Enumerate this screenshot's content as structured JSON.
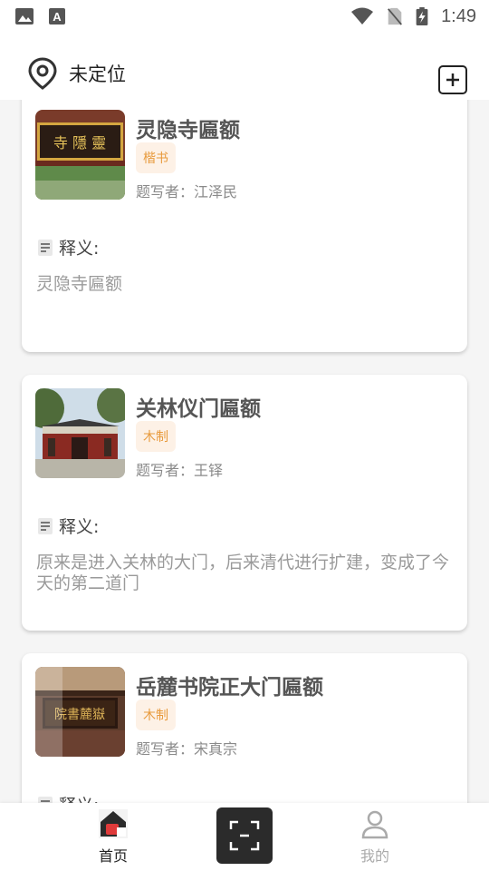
{
  "status_bar": {
    "time": "1:49",
    "left_icons": [
      "image-icon",
      "text-a-icon"
    ],
    "right_icons": [
      "wifi-icon",
      "no-sim-icon",
      "battery-charging-icon"
    ]
  },
  "header": {
    "location_label": "未定位",
    "location_icon": "location-pin-icon",
    "add_icon": "add-square-icon"
  },
  "cards": [
    {
      "title": "灵隐寺匾额",
      "tag": "楷书",
      "author": "题写者：江泽民",
      "shiyi_label": "释义:",
      "description": "灵隐寺匾额",
      "thumb_text": "寺 隱 靈"
    },
    {
      "title": "关林仪门匾额",
      "tag": "木制",
      "author": "题写者：王铎",
      "shiyi_label": "释义:",
      "description": "原来是进入关林的大门，后来清代进行扩建，变成了今天的第二道门"
    },
    {
      "title": "岳麓书院正大门匾额",
      "tag": "木制",
      "author": "题写者：宋真宗",
      "shiyi_label": "释义:",
      "description": "",
      "thumb_text": "院書麓嶽"
    }
  ],
  "bottom_nav": {
    "items": [
      {
        "label": "首页",
        "icon": "home-icon",
        "active": true
      },
      {
        "label": "",
        "icon": "scan-icon"
      },
      {
        "label": "我的",
        "icon": "user-icon",
        "active": false
      }
    ]
  },
  "colors": {
    "tag_bg": "#fdf1e6",
    "tag_text": "#e89a3c",
    "scan_bg": "#2b2b2b",
    "nav_active": "#222222",
    "nav_inactive": "#aaaaaa"
  }
}
